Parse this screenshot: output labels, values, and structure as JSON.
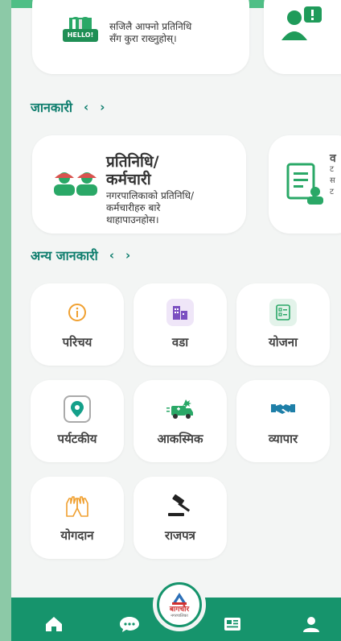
{
  "top_card": {
    "hello_badge": "HELLO!",
    "line1": "सजिलै आफ्नो प्रतिनिधि",
    "line2": "सँग कुरा राख्नुहोस्।"
  },
  "info_section": {
    "title": "जानकारी",
    "prev": "‹",
    "next": "›"
  },
  "rep_card": {
    "title_line1": "प्रतिनिधि/",
    "title_line2": "कर्मचारी",
    "desc_line1": "नगरपालिकाको प्रतिनिधि/",
    "desc_line2": "कर्मचारीहरु बारे",
    "desc_line3": "थाहापाउनहोस।"
  },
  "doc_card_partial": {
    "line1": "व",
    "line2": "ट",
    "line3": "स",
    "line4": "ट"
  },
  "other_section": {
    "title": "अन्य जानकारी",
    "prev": "‹",
    "next": "›"
  },
  "tiles": {
    "intro": "परिचय",
    "ward": "वडा",
    "plan": "योजना",
    "tourism": "पर्यटकीय",
    "emergency": "आकस्मिक",
    "business": "व्यापार",
    "contribution": "योगदान",
    "gazette": "राजपत्र"
  },
  "logo": {
    "name": "बागचौर",
    "sub": "नगरपालिका"
  },
  "colors": {
    "primary": "#16946c",
    "accent_text": "#0f7e6e",
    "frame_green": "#8cc9a7"
  }
}
